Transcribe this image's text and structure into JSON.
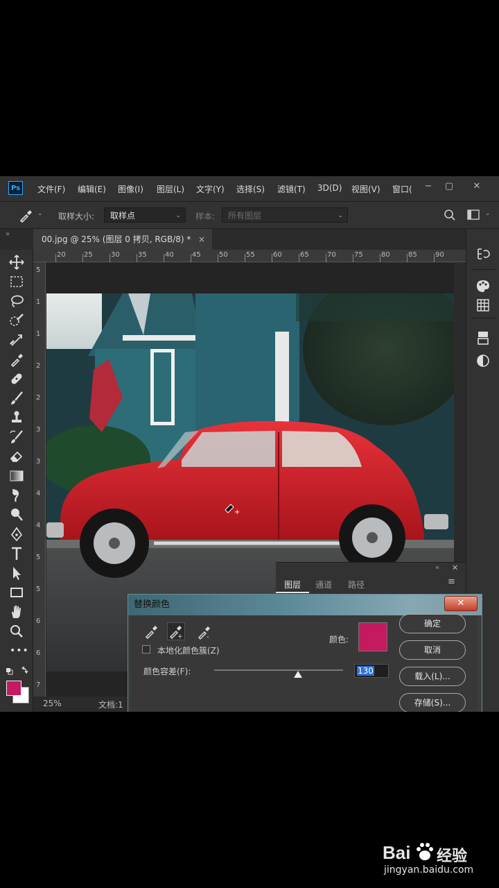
{
  "app": {
    "logo": "Ps",
    "menu": [
      "文件(F)",
      "编辑(E)",
      "图像(I)",
      "图层(L)",
      "文字(Y)",
      "选择(S)",
      "滤镜(T)",
      "3D(D)",
      "视图(V)",
      "窗口("
    ],
    "window_controls": {
      "minimize": "−",
      "maximize": "▢",
      "close": "✕"
    }
  },
  "options_bar": {
    "sample_size_label": "取样大小:",
    "sample_size_value": "取样点",
    "sample_label": "样本:",
    "sample_value": "所有图层"
  },
  "document": {
    "tab_title": "00.jpg @ 25% (图层 0 拷贝, RGB/8) *",
    "tab_close": "×",
    "zoom": "25%",
    "doc_info": "文档:1"
  },
  "rulers": {
    "horizontal": [
      "20",
      "25",
      "30",
      "35",
      "40",
      "45",
      "50",
      "55",
      "60",
      "65",
      "70",
      "75",
      "80",
      "85",
      "90"
    ],
    "vertical": [
      "5",
      "1",
      "1",
      "2",
      "2",
      "3",
      "3",
      "4",
      "4",
      "5",
      "5",
      "6",
      "6",
      "7"
    ]
  },
  "layers_panel": {
    "tabs": [
      "图层",
      "通道",
      "路径"
    ],
    "active_tab": 0
  },
  "dialog": {
    "title": "替换颜色",
    "close": "✕",
    "localized_label": "本地化颜色簇(Z)",
    "color_label": "颜色:",
    "fuzziness_label": "颜色容差(F):",
    "fuzziness_value": "130",
    "fuzziness_fraction": 0.65,
    "buttons": {
      "ok": "确定",
      "cancel": "取消",
      "load": "载入(L)...",
      "save": "存储(S)..."
    },
    "color_swatch": "#c41a5e"
  },
  "colors": {
    "foreground": "#c41a5e",
    "background": "#ffffff"
  },
  "watermark": {
    "brand": "Bai",
    "brand_cn": "经验",
    "url": "jingyan.baidu.com"
  }
}
